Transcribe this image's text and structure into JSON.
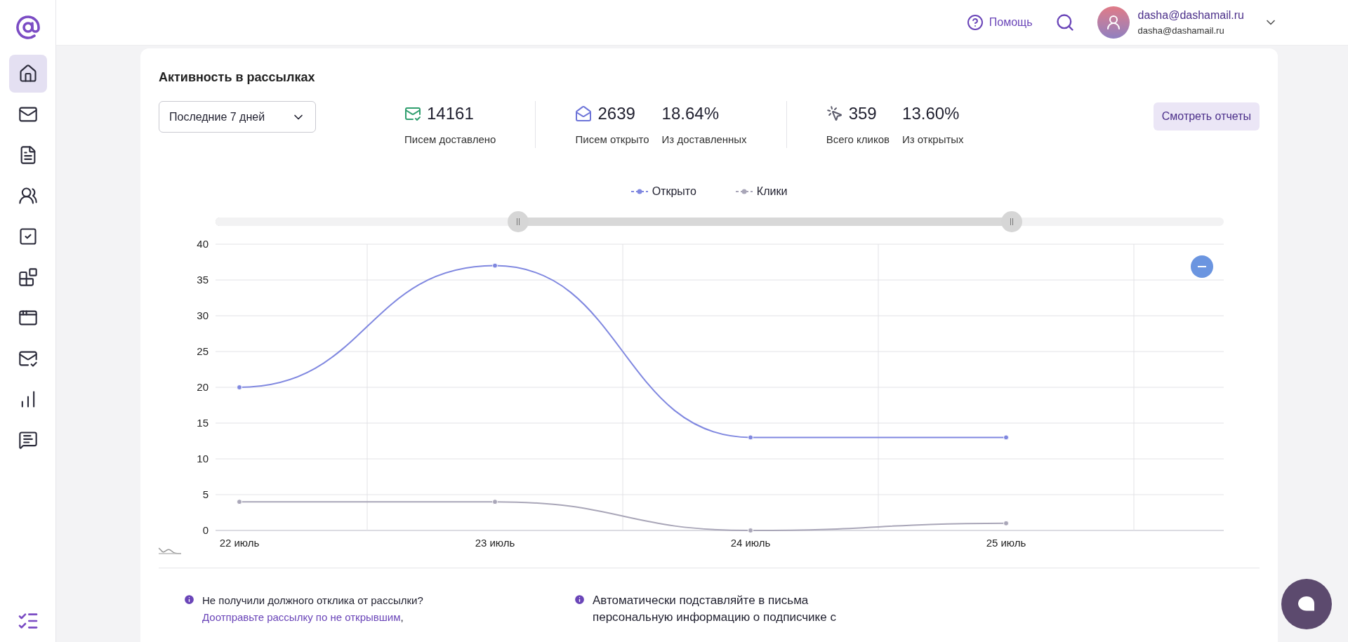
{
  "header": {
    "help": "Помощь",
    "user": {
      "name": "dasha@dashamail.ru",
      "email": "dasha@dashamail.ru"
    }
  },
  "sidebar": {
    "items": [
      {
        "selected": true
      },
      {
        "selected": false
      },
      {
        "selected": false
      },
      {
        "selected": false
      },
      {
        "selected": false
      },
      {
        "selected": false
      },
      {
        "selected": false
      },
      {
        "selected": false
      },
      {
        "selected": false
      },
      {
        "selected": false
      }
    ]
  },
  "activity": {
    "title": "Активность в рассылках",
    "period": {
      "value": "Последние 7 дней"
    },
    "stats": [
      {
        "value": "14161",
        "label": "Писем доставлено"
      },
      {
        "value": "2639",
        "label": "Писем открыто",
        "percent": "18.64%",
        "percent_label": "Из доставленных"
      },
      {
        "value": "359",
        "label": "Всего кликов",
        "percent": "13.60%",
        "percent_label": "Из открытых"
      }
    ],
    "reports_button": "Смотреть отчеты",
    "zoom_range": {
      "handles": [
        {
          "level": 0.3
        },
        {
          "level": 0.79
        }
      ]
    },
    "chart_data": {
      "type": "line",
      "categories": [
        "22 июль",
        "23 июль",
        "24 июль",
        "25 июль"
      ],
      "grid": true,
      "series": [
        {
          "name": "Открыто",
          "color": "#8088e0",
          "marker": true,
          "values": [
            20,
            37,
            13,
            13
          ]
        },
        {
          "name": "Клики",
          "color": "#a9a6b8",
          "marker": true,
          "values": [
            4,
            4,
            0,
            1
          ]
        }
      ],
      "ylim": [
        0,
        40
      ],
      "yticks": [
        0,
        5,
        10,
        15,
        20,
        25,
        30,
        35,
        40
      ]
    }
  },
  "tips": [
    {
      "text": "Не получили должного отклика от рассылки?",
      "link": "Доотправьте рассылку по не открывшим",
      "after": ","
    },
    {
      "text": "Автоматически подставляйте в письма персональную информацию о подписчике с"
    }
  ]
}
